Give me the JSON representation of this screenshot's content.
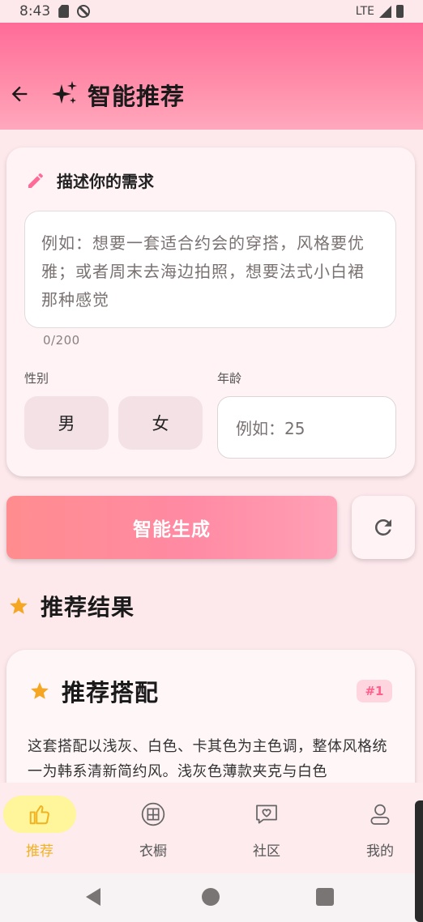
{
  "status_bar": {
    "time": "8:43",
    "network": "LTE"
  },
  "header": {
    "title": "智能推荐",
    "back_icon": "arrow-left-icon",
    "title_icon": "sparkle-icon"
  },
  "request": {
    "title": "描述你的需求",
    "placeholder": "例如：想要一套适合约会的穿搭，风格要优雅；或者周末去海边拍照，想要法式小白裙那种感觉",
    "counter": "0/200",
    "gender_label": "性别",
    "gender_options": [
      "男",
      "女"
    ],
    "age_label": "年龄",
    "age_placeholder": "例如：25"
  },
  "actions": {
    "generate_label": "智能生成",
    "refresh_icon": "refresh-icon"
  },
  "results": {
    "section_title": "推荐结果",
    "card": {
      "title": "推荐搭配",
      "rank": "#1",
      "description": "这套搭配以浅灰、白色、卡其色为主色调，整体风格统一为韩系清新简约风。浅灰色薄款夹克与白色"
    }
  },
  "bottom_nav": [
    {
      "label": "推荐",
      "icon": "thumbs-up-icon",
      "active": true
    },
    {
      "label": "衣橱",
      "icon": "wardrobe-icon",
      "active": false
    },
    {
      "label": "社区",
      "icon": "chat-heart-icon",
      "active": false
    },
    {
      "label": "我的",
      "icon": "person-icon",
      "active": false
    }
  ],
  "colors": {
    "primary": "#ff6b98",
    "accent_star": "#f5a623",
    "active_nav": "#f0b21f",
    "active_nav_bg": "#fff59a",
    "background": "#fde9ec"
  }
}
